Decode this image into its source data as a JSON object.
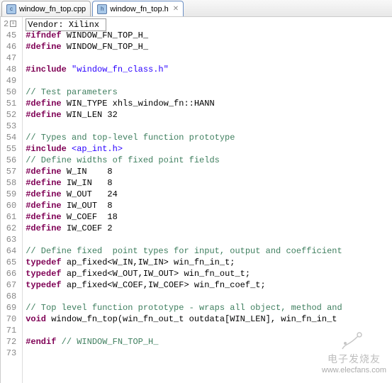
{
  "tabs": [
    {
      "label": "window_fn_top.cpp",
      "icon": "c",
      "active": false
    },
    {
      "label": "window_fn_top.h",
      "icon": "h",
      "active": true
    }
  ],
  "close_glyph": "✕",
  "fold_collapsed": "+",
  "gutter_first": "2",
  "lines": [
    {
      "num": "",
      "segs": [
        {
          "cls": "k-id first-line-box",
          "t": "Vendor: Xilinx "
        }
      ]
    },
    {
      "num": "45",
      "segs": [
        {
          "cls": "k-pp",
          "t": "#ifndef"
        },
        {
          "cls": "k-id",
          "t": " WINDOW_FN_TOP_H_"
        }
      ]
    },
    {
      "num": "46",
      "segs": [
        {
          "cls": "k-pp",
          "t": "#define"
        },
        {
          "cls": "k-id",
          "t": " WINDOW_FN_TOP_H_"
        }
      ]
    },
    {
      "num": "47",
      "segs": []
    },
    {
      "num": "48",
      "segs": [
        {
          "cls": "k-pp",
          "t": "#include "
        },
        {
          "cls": "k-str",
          "t": "\"window_fn_class.h\""
        }
      ]
    },
    {
      "num": "49",
      "segs": []
    },
    {
      "num": "50",
      "segs": [
        {
          "cls": "k-cmt",
          "t": "// Test parameters"
        }
      ]
    },
    {
      "num": "51",
      "segs": [
        {
          "cls": "k-pp",
          "t": "#define"
        },
        {
          "cls": "k-id",
          "t": " WIN_TYPE xhls_window_fn::HANN"
        }
      ]
    },
    {
      "num": "52",
      "segs": [
        {
          "cls": "k-pp",
          "t": "#define"
        },
        {
          "cls": "k-id",
          "t": " WIN_LEN 32"
        }
      ]
    },
    {
      "num": "53",
      "segs": []
    },
    {
      "num": "54",
      "segs": [
        {
          "cls": "k-cmt",
          "t": "// Types and top-level function prototype"
        }
      ]
    },
    {
      "num": "55",
      "segs": [
        {
          "cls": "k-pp",
          "t": "#include "
        },
        {
          "cls": "k-inc",
          "t": "<ap_int.h>"
        }
      ]
    },
    {
      "num": "56",
      "segs": [
        {
          "cls": "k-cmt",
          "t": "// Define widths of fixed point fields"
        }
      ]
    },
    {
      "num": "57",
      "segs": [
        {
          "cls": "k-pp",
          "t": "#define"
        },
        {
          "cls": "k-id",
          "t": " W_IN    8"
        }
      ]
    },
    {
      "num": "58",
      "segs": [
        {
          "cls": "k-pp",
          "t": "#define"
        },
        {
          "cls": "k-id",
          "t": " IW_IN   8"
        }
      ]
    },
    {
      "num": "59",
      "segs": [
        {
          "cls": "k-pp",
          "t": "#define"
        },
        {
          "cls": "k-id",
          "t": " W_OUT   24"
        }
      ]
    },
    {
      "num": "60",
      "segs": [
        {
          "cls": "k-pp",
          "t": "#define"
        },
        {
          "cls": "k-id",
          "t": " IW_OUT  8"
        }
      ]
    },
    {
      "num": "61",
      "segs": [
        {
          "cls": "k-pp",
          "t": "#define"
        },
        {
          "cls": "k-id",
          "t": " W_COEF  18"
        }
      ]
    },
    {
      "num": "62",
      "segs": [
        {
          "cls": "k-pp",
          "t": "#define"
        },
        {
          "cls": "k-id",
          "t": " IW_COEF 2"
        }
      ]
    },
    {
      "num": "63",
      "segs": []
    },
    {
      "num": "64",
      "segs": [
        {
          "cls": "k-cmt",
          "t": "// Define fixed  point types for input, output and coefficient"
        }
      ]
    },
    {
      "num": "65",
      "segs": [
        {
          "cls": "k-kw",
          "t": "typedef"
        },
        {
          "cls": "k-id",
          "t": " ap_fixed<W_IN,IW_IN> win_fn_in_t;"
        }
      ]
    },
    {
      "num": "66",
      "segs": [
        {
          "cls": "k-kw",
          "t": "typedef"
        },
        {
          "cls": "k-id",
          "t": " ap_fixed<W_OUT,IW_OUT> win_fn_out_t;"
        }
      ]
    },
    {
      "num": "67",
      "segs": [
        {
          "cls": "k-kw",
          "t": "typedef"
        },
        {
          "cls": "k-id",
          "t": " ap_fixed<W_COEF,IW_COEF> win_fn_coef_t;"
        }
      ]
    },
    {
      "num": "68",
      "segs": []
    },
    {
      "num": "69",
      "segs": [
        {
          "cls": "k-cmt",
          "t": "// Top level function prototype - wraps all object, method and "
        }
      ]
    },
    {
      "num": "70",
      "segs": [
        {
          "cls": "k-kw",
          "t": "void"
        },
        {
          "cls": "k-id",
          "t": " window_fn_top(win_fn_out_t outdata[WIN_LEN], win_fn_in_t "
        }
      ]
    },
    {
      "num": "71",
      "segs": []
    },
    {
      "num": "72",
      "segs": [
        {
          "cls": "k-pp",
          "t": "#endif"
        },
        {
          "cls": "k-id",
          "t": " "
        },
        {
          "cls": "k-cmt",
          "t": "// WINDOW_FN_TOP_H_"
        }
      ]
    },
    {
      "num": "73",
      "segs": []
    }
  ],
  "watermark": {
    "brand": "电子发烧友",
    "url": "www.elecfans.com"
  }
}
